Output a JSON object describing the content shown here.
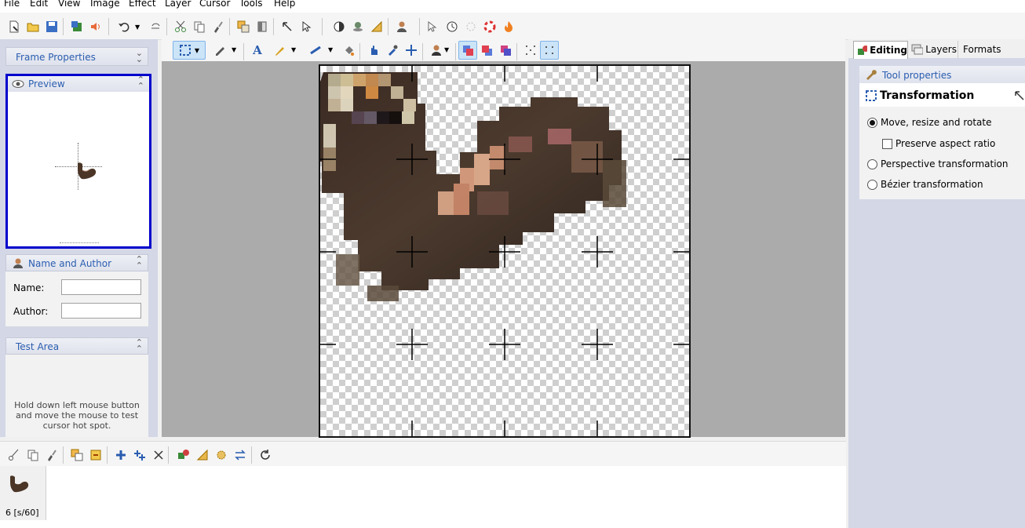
{
  "menu": [
    "File",
    "Edit",
    "View",
    "Image",
    "Effect",
    "Layer",
    "Cursor",
    "Tools",
    "Help"
  ],
  "left": {
    "frame_properties": "Frame Properties",
    "preview": "Preview",
    "name_and_author": "Name and Author",
    "name_label": "Name:",
    "author_label": "Author:",
    "name_value": "",
    "author_value": "",
    "test_area": "Test Area",
    "test_hint": "Hold down left mouse button and move the mouse to test cursor hot spot."
  },
  "right": {
    "tabs": [
      "Editing",
      "Layers",
      "Formats"
    ],
    "tool_properties": "Tool properties",
    "tool_title": "Transformation",
    "options": [
      "Move, resize and rotate",
      "Preserve aspect ratio",
      "Perspective transformation",
      "Bézier transformation"
    ],
    "selected_option": "Move, resize and rotate",
    "preserve_aspect_checked": false
  },
  "frames": [
    {
      "label": "6 [s/60]"
    }
  ],
  "colors": {
    "accent": "#2a5db0",
    "panel": "#d3d7e6",
    "canvas_bg": "#ababab",
    "selection_border": "#0000cc"
  }
}
